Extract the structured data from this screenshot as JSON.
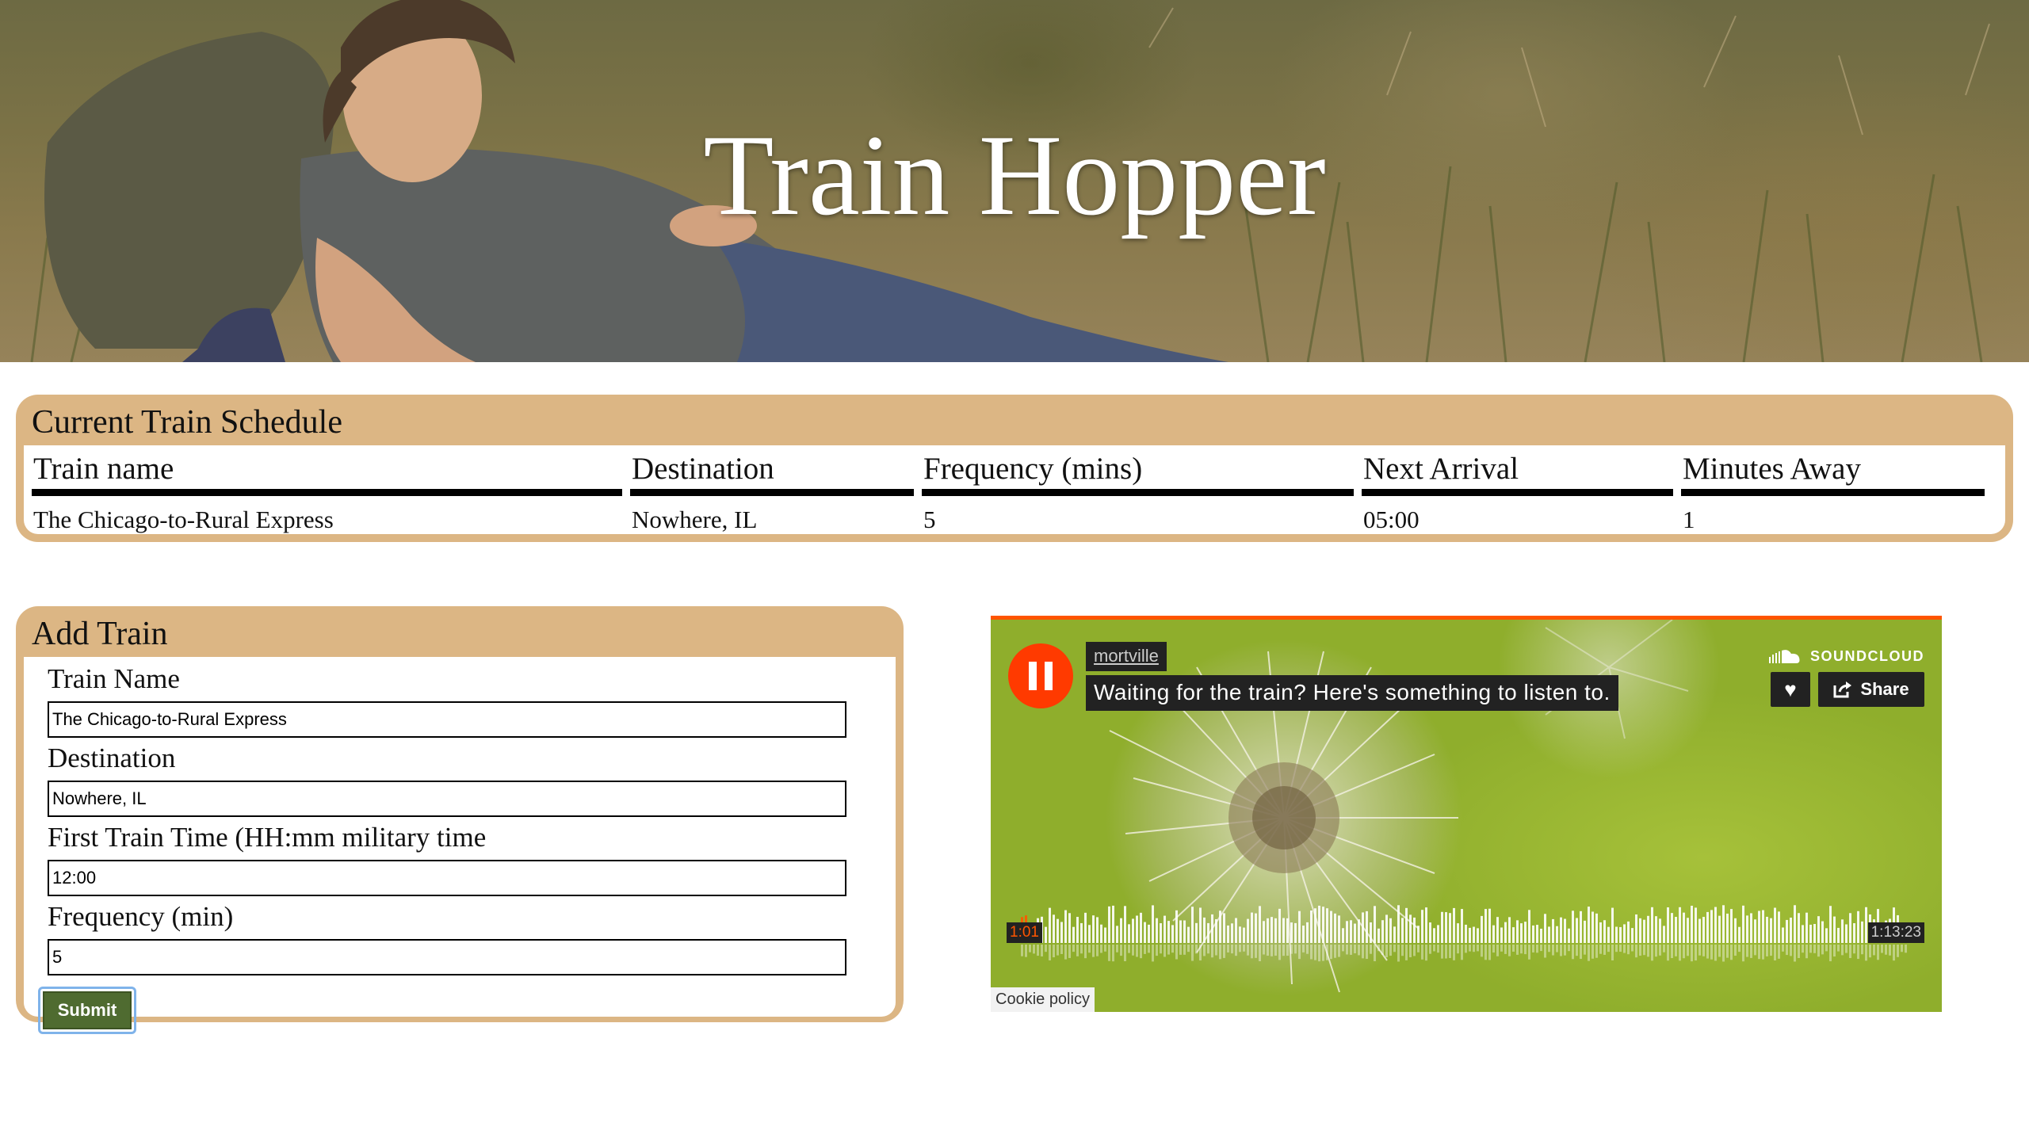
{
  "header": {
    "title": "Train Hopper"
  },
  "schedule": {
    "title": "Current Train Schedule",
    "columns": [
      "Train name",
      "Destination",
      "Frequency (mins)",
      "Next Arrival",
      "Minutes Away"
    ],
    "rows": [
      [
        "The Chicago-to-Rural Express",
        "Nowhere, IL",
        "5",
        "05:00",
        "1"
      ]
    ]
  },
  "add_train": {
    "title": "Add Train",
    "fields": [
      {
        "label": "Train Name",
        "value": "The Chicago-to-Rural Express"
      },
      {
        "label": "Destination",
        "value": "Nowhere, IL"
      },
      {
        "label": "First Train Time (HH:mm military time",
        "value": "12:00"
      },
      {
        "label": "Frequency (min)",
        "value": "5"
      }
    ],
    "submit_label": "Submit"
  },
  "player": {
    "user": "mortville",
    "track_title": "Waiting for the train? Here's something to listen to.",
    "brand": "SOUNDCLOUD",
    "share_label": "Share",
    "time_elapsed": "1:01",
    "time_total": "1:13:23",
    "cookie_label": "Cookie policy",
    "state": "playing",
    "progress": 0.014,
    "accent_color": "#ff5500",
    "icons": [
      "pause-icon",
      "soundcloud-logo-icon",
      "heart-icon",
      "share-icon"
    ]
  },
  "colors": {
    "panel": "#dcb684",
    "submit": "#4f6b30"
  }
}
